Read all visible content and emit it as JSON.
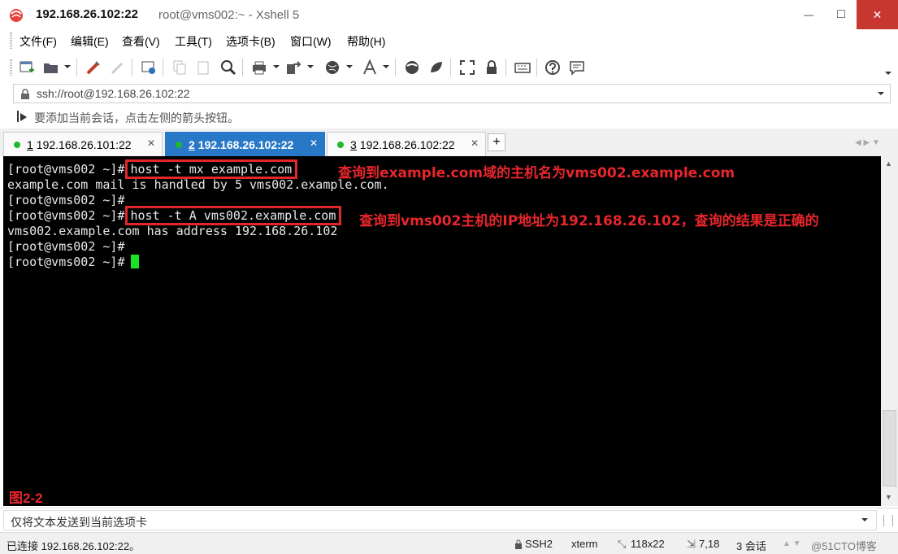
{
  "window": {
    "title_host": "192.168.26.102:22",
    "title_rest": "root@vms002:~ - Xshell 5",
    "minimize": "—",
    "maximize": "□",
    "close": "✕"
  },
  "menu": [
    "文件(F)",
    "编辑(E)",
    "查看(V)",
    "工具(T)",
    "选项卡(B)",
    "窗口(W)",
    "帮助(H)"
  ],
  "address": "ssh://root@192.168.26.102:22",
  "hint": "要添加当前会话，点击左侧的箭头按钮。",
  "tabs": [
    {
      "num": "1",
      "label": "192.168.26.101:22"
    },
    {
      "num": "2",
      "label": "192.168.26.102:22"
    },
    {
      "num": "3",
      "label": "192.168.26.102:22"
    }
  ],
  "tab_add": "+",
  "terminal": {
    "prompt": "[root@vms002 ~]#",
    "cmd1": "host -t mx example.com",
    "out1": "example.com mail is handled by 5 vms002.example.com.",
    "cmd2": "host -t A vms002.example.com",
    "out2": "vms002.example.com has address 192.168.26.102",
    "note1": "查询到example.com域的主机名为vms002.example.com",
    "note2": "查询到vms002主机的IP地址为192.168.26.102，查询的结果是正确的",
    "figure_label": "图2-2"
  },
  "send_placeholder": "仅将文本发送到当前选项卡",
  "status": {
    "connection": "已连接 192.168.26.102:22。",
    "protocol": "SSH2",
    "term": "xterm",
    "size": "118x22",
    "cursor_pos": "7,18",
    "sessions": "3 会话",
    "watermark": "@51CTO博客"
  },
  "colors": {
    "accent_tab": "#2878c8",
    "annotation": "#e8262c",
    "cursor": "#18e623",
    "close_button": "#c7372f"
  }
}
